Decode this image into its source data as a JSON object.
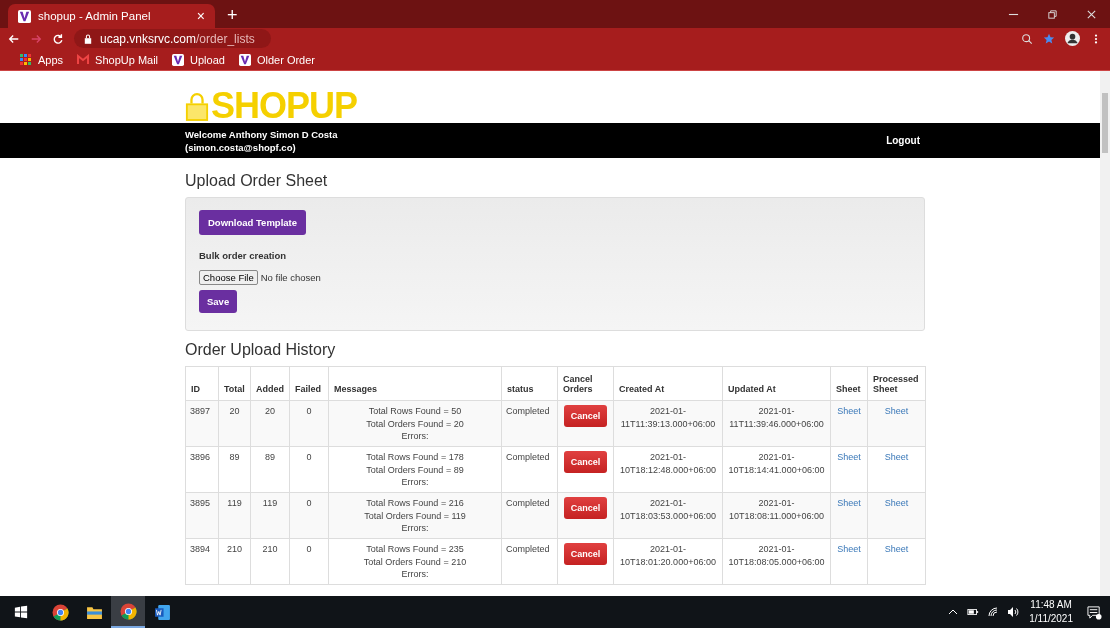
{
  "browser": {
    "tab": {
      "title": "shopup - Admin Panel",
      "close": "×",
      "selected": true
    },
    "new_tab": "+",
    "url_host": "ucap.vnksrvc.com",
    "url_path": "/order_lists",
    "bookmarks": [
      {
        "label": "Apps",
        "kind": "apps"
      },
      {
        "label": "ShopUp Mail",
        "kind": "mail"
      },
      {
        "label": "Upload",
        "kind": "site"
      },
      {
        "label": "Older Order",
        "kind": "site"
      }
    ]
  },
  "header": {
    "logo": "SHOPUP",
    "welcome": "Welcome Anthony Simon D Costa",
    "email": "(simon.costa@shopf.co)",
    "logout": "Logout"
  },
  "upload": {
    "title": "Upload Order Sheet",
    "download_button": "Download Template",
    "label": "Bulk order creation",
    "choose_file": "Choose File",
    "file_status": "No file chosen",
    "save_button": "Save"
  },
  "history": {
    "title": "Order Upload History",
    "columns": [
      "ID",
      "Total",
      "Added",
      "Failed",
      "Messages",
      "status",
      "Cancel Orders",
      "Created At",
      "Updated At",
      "Sheet",
      "Processed Sheet"
    ],
    "rows": [
      {
        "id": "3897",
        "total": "20",
        "added": "20",
        "failed": "0",
        "messages": [
          "Total Rows Found = 50",
          "Total Orders Found = 20",
          "Errors:"
        ],
        "status": "Completed",
        "cancel": "Cancel",
        "created": "2021-01-11T11:39:13.000+06:00",
        "updated": "2021-01-11T11:39:46.000+06:00",
        "sheet": "Sheet",
        "processed": "Sheet"
      },
      {
        "id": "3896",
        "total": "89",
        "added": "89",
        "failed": "0",
        "messages": [
          "Total Rows Found = 178",
          "Total Orders Found = 89",
          "Errors:"
        ],
        "status": "Completed",
        "cancel": "Cancel",
        "created": "2021-01-10T18:12:48.000+06:00",
        "updated": "2021-01-10T18:14:41.000+06:00",
        "sheet": "Sheet",
        "processed": "Sheet"
      },
      {
        "id": "3895",
        "total": "119",
        "added": "119",
        "failed": "0",
        "messages": [
          "Total Rows Found = 216",
          "Total Orders Found = 119",
          "Errors:"
        ],
        "status": "Completed",
        "cancel": "Cancel",
        "created": "2021-01-10T18:03:53.000+06:00",
        "updated": "2021-01-10T18:08:11.000+06:00",
        "sheet": "Sheet",
        "processed": "Sheet"
      },
      {
        "id": "3894",
        "total": "210",
        "added": "210",
        "failed": "0",
        "messages": [
          "Total Rows Found = 235",
          "Total Orders Found = 210",
          "Errors:"
        ],
        "status": "Completed",
        "cancel": "Cancel",
        "created": "2021-01-10T18:01:20.000+06:00",
        "updated": "2021-01-10T18:08:05.000+06:00",
        "sheet": "Sheet",
        "processed": "Sheet"
      }
    ]
  },
  "taskbar": {
    "apps": [
      {
        "kind": "chrome",
        "selected": false
      },
      {
        "kind": "folder",
        "selected": false
      },
      {
        "kind": "chrome",
        "selected": true
      },
      {
        "kind": "word",
        "selected": false
      }
    ],
    "time": "11:48 AM",
    "date": "1/11/2021"
  }
}
